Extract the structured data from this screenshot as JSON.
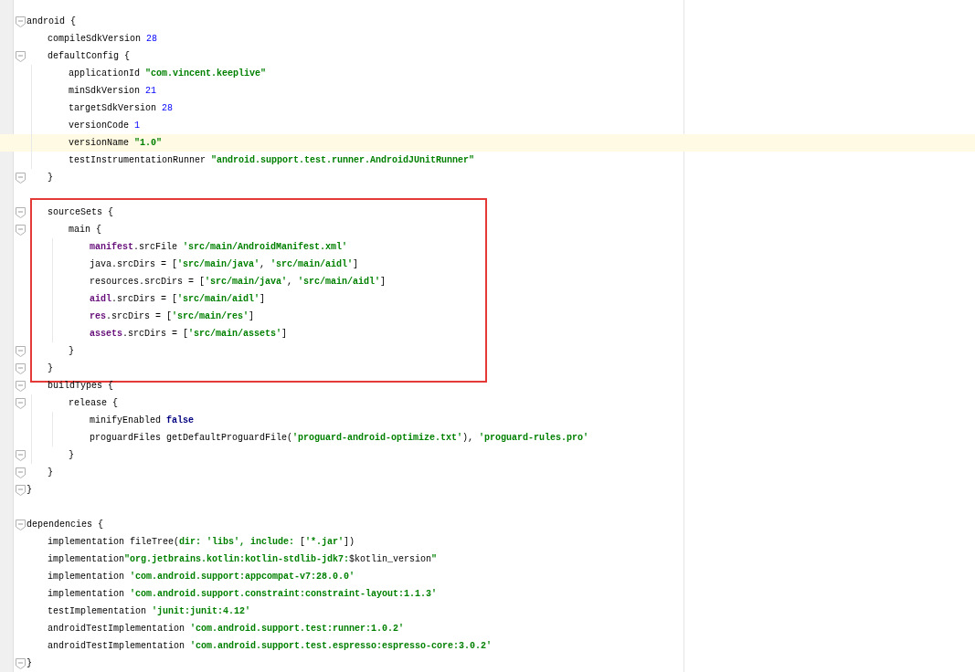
{
  "editor": {
    "lines": [
      {
        "kind": "block",
        "boxed": false,
        "tokens": [
          {
            "kind": "plain",
            "text": "android {"
          }
        ],
        "end": [
          {
            "kind": "plain",
            "text": "}"
          }
        ],
        "children": [
          {
            "kind": "line",
            "highlighted": false,
            "tokens": [
              {
                "kind": "plain",
                "text": "compileSdkVersion "
              },
              {
                "kind": "number",
                "text": "28"
              }
            ]
          },
          {
            "kind": "block",
            "boxed": false,
            "tokens": [
              {
                "kind": "plain",
                "text": "defaultConfig {"
              }
            ],
            "end": [
              {
                "kind": "plain",
                "text": "}"
              }
            ],
            "children": [
              {
                "kind": "line",
                "highlighted": false,
                "tokens": [
                  {
                    "kind": "plain",
                    "text": "applicationId "
                  },
                  {
                    "kind": "string",
                    "text": "\"com.vincent.keeplive\""
                  }
                ]
              },
              {
                "kind": "line",
                "highlighted": false,
                "tokens": [
                  {
                    "kind": "plain",
                    "text": "minSdkVersion "
                  },
                  {
                    "kind": "number",
                    "text": "21"
                  }
                ]
              },
              {
                "kind": "line",
                "highlighted": false,
                "tokens": [
                  {
                    "kind": "plain",
                    "text": "targetSdkVersion "
                  },
                  {
                    "kind": "number",
                    "text": "28"
                  }
                ]
              },
              {
                "kind": "line",
                "highlighted": false,
                "tokens": [
                  {
                    "kind": "plain",
                    "text": "versionCode "
                  },
                  {
                    "kind": "number",
                    "text": "1"
                  }
                ]
              },
              {
                "kind": "line",
                "highlighted": true,
                "tokens": [
                  {
                    "kind": "plain",
                    "text": "versionName "
                  },
                  {
                    "kind": "string",
                    "text": "\"1.0\""
                  }
                ]
              },
              {
                "kind": "line",
                "highlighted": false,
                "tokens": [
                  {
                    "kind": "plain",
                    "text": "testInstrumentationRunner "
                  },
                  {
                    "kind": "string",
                    "text": "\"android.support.test.runner.AndroidJUnitRunner\""
                  }
                ]
              }
            ]
          },
          {
            "kind": "blank"
          },
          {
            "kind": "block",
            "boxed": true,
            "tokens": [
              {
                "kind": "plain",
                "text": "sourceSets {"
              }
            ],
            "end": [
              {
                "kind": "plain",
                "text": "}"
              }
            ],
            "children": [
              {
                "kind": "block",
                "boxed": false,
                "tokens": [
                  {
                    "kind": "plain",
                    "text": "main {"
                  }
                ],
                "end": [
                  {
                    "kind": "plain",
                    "text": "}"
                  }
                ],
                "children": [
                  {
                    "kind": "line",
                    "highlighted": false,
                    "tokens": [
                      {
                        "kind": "field",
                        "text": "manifest"
                      },
                      {
                        "kind": "plain",
                        "text": ".srcFile "
                      },
                      {
                        "kind": "string",
                        "text": "'src/main/AndroidManifest.xml'"
                      }
                    ]
                  },
                  {
                    "kind": "line",
                    "highlighted": false,
                    "tokens": [
                      {
                        "kind": "plain",
                        "text": "java.srcDirs = ["
                      },
                      {
                        "kind": "string",
                        "text": "'src/main/java'"
                      },
                      {
                        "kind": "plain",
                        "text": ", "
                      },
                      {
                        "kind": "string",
                        "text": "'src/main/aidl'"
                      },
                      {
                        "kind": "plain",
                        "text": "]"
                      }
                    ]
                  },
                  {
                    "kind": "line",
                    "highlighted": false,
                    "tokens": [
                      {
                        "kind": "plain",
                        "text": "resources.srcDirs = ["
                      },
                      {
                        "kind": "string",
                        "text": "'src/main/java'"
                      },
                      {
                        "kind": "plain",
                        "text": ", "
                      },
                      {
                        "kind": "string",
                        "text": "'src/main/aidl'"
                      },
                      {
                        "kind": "plain",
                        "text": "]"
                      }
                    ]
                  },
                  {
                    "kind": "line",
                    "highlighted": false,
                    "tokens": [
                      {
                        "kind": "field",
                        "text": "aidl"
                      },
                      {
                        "kind": "plain",
                        "text": ".srcDirs = ["
                      },
                      {
                        "kind": "string",
                        "text": "'src/main/aidl'"
                      },
                      {
                        "kind": "plain",
                        "text": "]"
                      }
                    ]
                  },
                  {
                    "kind": "line",
                    "highlighted": false,
                    "tokens": [
                      {
                        "kind": "field",
                        "text": "res"
                      },
                      {
                        "kind": "plain",
                        "text": ".srcDirs = ["
                      },
                      {
                        "kind": "string",
                        "text": "'src/main/res'"
                      },
                      {
                        "kind": "plain",
                        "text": "]"
                      }
                    ]
                  },
                  {
                    "kind": "line",
                    "highlighted": false,
                    "tokens": [
                      {
                        "kind": "field",
                        "text": "assets"
                      },
                      {
                        "kind": "plain",
                        "text": ".srcDirs = ["
                      },
                      {
                        "kind": "string",
                        "text": "'src/main/assets'"
                      },
                      {
                        "kind": "plain",
                        "text": "]"
                      }
                    ]
                  }
                ]
              }
            ]
          },
          {
            "kind": "block",
            "boxed": false,
            "tokens": [
              {
                "kind": "plain",
                "text": "buildTypes {"
              }
            ],
            "end": [
              {
                "kind": "plain",
                "text": "}"
              }
            ],
            "children": [
              {
                "kind": "block",
                "boxed": false,
                "tokens": [
                  {
                    "kind": "plain",
                    "text": "release {"
                  }
                ],
                "end": [
                  {
                    "kind": "plain",
                    "text": "}"
                  }
                ],
                "children": [
                  {
                    "kind": "line",
                    "highlighted": false,
                    "tokens": [
                      {
                        "kind": "plain",
                        "text": "minifyEnabled "
                      },
                      {
                        "kind": "keyword",
                        "text": "false"
                      }
                    ]
                  },
                  {
                    "kind": "line",
                    "highlighted": false,
                    "tokens": [
                      {
                        "kind": "plain",
                        "text": "proguardFiles getDefaultProguardFile("
                      },
                      {
                        "kind": "string",
                        "text": "'proguard-android-optimize.txt'"
                      },
                      {
                        "kind": "plain",
                        "text": "), "
                      },
                      {
                        "kind": "string",
                        "text": "'proguard-rules.pro'"
                      }
                    ]
                  }
                ]
              }
            ]
          }
        ]
      },
      {
        "kind": "blank"
      },
      {
        "kind": "block",
        "boxed": false,
        "tokens": [
          {
            "kind": "plain",
            "text": "dependencies {"
          }
        ],
        "end": [
          {
            "kind": "plain",
            "text": "}"
          }
        ],
        "children": [
          {
            "kind": "line",
            "highlighted": false,
            "tokens": [
              {
                "kind": "plain",
                "text": "implementation fileTree("
              },
              {
                "kind": "string",
                "text": "dir: 'libs', include: "
              },
              {
                "kind": "plain",
                "text": "["
              },
              {
                "kind": "string",
                "text": "'*.jar'"
              },
              {
                "kind": "plain",
                "text": "])"
              }
            ]
          },
          {
            "kind": "line",
            "highlighted": false,
            "tokens": [
              {
                "kind": "plain",
                "text": "implementation"
              },
              {
                "kind": "string",
                "text": "\"org.jetbrains.kotlin:kotlin-stdlib-jdk7:"
              },
              {
                "kind": "plain",
                "text": "$kotlin_version"
              },
              {
                "kind": "string",
                "text": "\""
              }
            ]
          },
          {
            "kind": "line",
            "highlighted": false,
            "tokens": [
              {
                "kind": "plain",
                "text": "implementation "
              },
              {
                "kind": "string",
                "text": "'com.android.support:appcompat-v7:28.0.0'"
              }
            ]
          },
          {
            "kind": "line",
            "highlighted": false,
            "tokens": [
              {
                "kind": "plain",
                "text": "implementation "
              },
              {
                "kind": "string",
                "text": "'com.android.support.constraint:constraint-layout:1.1.3'"
              }
            ]
          },
          {
            "kind": "line",
            "highlighted": false,
            "tokens": [
              {
                "kind": "plain",
                "text": "testImplementation "
              },
              {
                "kind": "string",
                "text": "'junit:junit:4.12'"
              }
            ]
          },
          {
            "kind": "line",
            "highlighted": false,
            "tokens": [
              {
                "kind": "plain",
                "text": "androidTestImplementation "
              },
              {
                "kind": "string",
                "text": "'com.android.support.test:runner:1.0.2'"
              }
            ]
          },
          {
            "kind": "line",
            "highlighted": false,
            "tokens": [
              {
                "kind": "plain",
                "text": "androidTestImplementation "
              },
              {
                "kind": "string",
                "text": "'com.android.support.test.espresso:espresso-core:3.0.2'"
              }
            ]
          }
        ]
      }
    ]
  }
}
